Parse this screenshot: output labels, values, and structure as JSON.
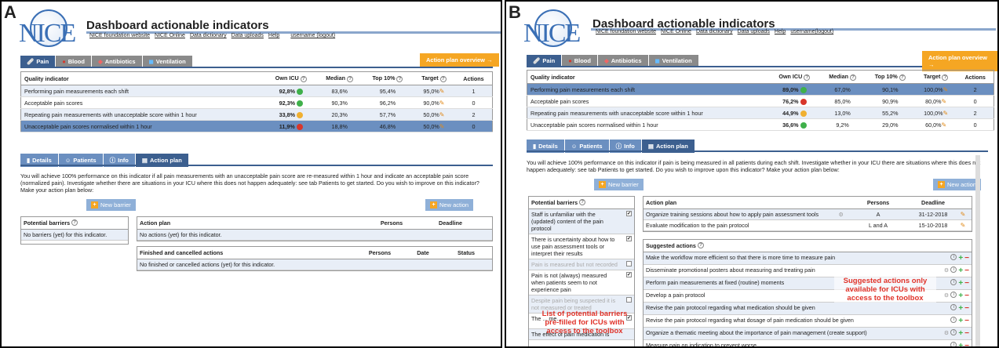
{
  "panelA": {
    "label": "A",
    "title": "Dashboard actionable indicators",
    "links": [
      "NICE foundation website",
      "NICE Online",
      "Data dictionary",
      "Data uploads",
      "Help",
      "username (logout)"
    ],
    "tabs": [
      "Pain",
      "Blood",
      "Antibiotics",
      "Ventilation"
    ],
    "action_plan_btn": "Action plan overview →",
    "table": {
      "headers": [
        "Quality indicator",
        "Own ICU",
        "Median",
        "Top 10%",
        "Target",
        "Actions"
      ],
      "rows": [
        {
          "qi": "Performing pain measurements each shift",
          "own": "92,8%",
          "median": "83,6%",
          "top": "95,4%",
          "target": "95,0%",
          "actions": "1",
          "status": "g"
        },
        {
          "qi": "Acceptable pain scores",
          "own": "92,3%",
          "median": "90,3%",
          "top": "96,2%",
          "target": "90,0%",
          "actions": "0",
          "status": "g"
        },
        {
          "qi": "Repeating pain measurements with unacceptable score within 1 hour",
          "own": "33,8%",
          "median": "20,3%",
          "top": "57,7%",
          "target": "50,0%",
          "actions": "2",
          "status": "o"
        },
        {
          "qi": "Unacceptable pain scores normalised within 1 hour",
          "own": "11,9%",
          "median": "18,8%",
          "top": "46,8%",
          "target": "50,0%",
          "actions": "0",
          "status": "r"
        }
      ]
    },
    "subtabs": [
      "Details",
      "Patients",
      "Info",
      "Action plan"
    ],
    "para": "You will achieve 100% performance on this indicator if all pain measurements with an unacceptable pain score are re-measured within 1 hour and indicate an acceptable pain score (normalized pain). Investigate whether there are situations in your ICU where this does not happen adequately: see tab Patients to get started. Do you wish to improve on this indicator? Make your action plan below:",
    "new_barrier": "New barrier",
    "new_action": "New action",
    "barriers_head": "Potential barriers",
    "barriers_empty": "No barriers (yet) for this indicator.",
    "ap_head": [
      "Action plan",
      "Persons",
      "Deadline"
    ],
    "ap_empty": "No actions (yet) for this indicator.",
    "fin_head": [
      "Finished and cancelled actions",
      "Persons",
      "Date",
      "Status"
    ],
    "fin_empty": "No finished or cancelled actions (yet) for this indicator."
  },
  "panelB": {
    "label": "B",
    "title": "Dashboard actionable indicators",
    "links": [
      "NICE foundation website",
      "NICE Online",
      "Data dictionary",
      "Data uploads",
      "Help",
      "username(logout)"
    ],
    "tabs": [
      "Pain",
      "Blood",
      "Antibiotics",
      "Ventilation"
    ],
    "action_plan_btn": "Action plan overview →",
    "table": {
      "headers": [
        "Quality indicator",
        "Own ICU",
        "Median",
        "Top 10%",
        "Target",
        "Actions"
      ],
      "rows": [
        {
          "qi": "Performing pain measurements each shift",
          "own": "89,0%",
          "median": "67,0%",
          "top": "90,1%",
          "target": "100,0%",
          "actions": "2",
          "status": "g"
        },
        {
          "qi": "Acceptable pain scores",
          "own": "76,2%",
          "median": "85,0%",
          "top": "90,9%",
          "target": "80,0%",
          "actions": "0",
          "status": "r"
        },
        {
          "qi": "Repeating pain measurements with unacceptable score within 1 hour",
          "own": "44,9%",
          "median": "13,0%",
          "top": "55,2%",
          "target": "100,0%",
          "actions": "2",
          "status": "o"
        },
        {
          "qi": "Unacceptable pain scores normalised within 1 hour",
          "own": "36,6%",
          "median": "9,2%",
          "top": "29,0%",
          "target": "60,0%",
          "actions": "0",
          "status": "g"
        }
      ]
    },
    "subtabs": [
      "Details",
      "Patients",
      "Info",
      "Action plan"
    ],
    "para": "You will achieve 100% performance on this indicator if pain is being measured in all patients during each shift. Investigate whether in your ICU there are situations where this does not happen adequately: see tab Patients to get started. Do you wish to improve upon this indicator? Make your action plan below:",
    "new_barrier": "New barrier",
    "new_action": "New action",
    "barriers_head": "Potential barriers",
    "barriers": [
      {
        "text": "Staff is unfamiliar with the (updated) content of the pain protocol",
        "checked": true,
        "muted": false
      },
      {
        "text": "There is uncertainty about how to use pain assessment tools or interpret their results",
        "checked": true,
        "muted": false
      },
      {
        "text": "Pain is measured but not recorded",
        "checked": false,
        "muted": true
      },
      {
        "text": "Pain is not (always) measured when patients seem to not experience pain",
        "checked": true,
        "muted": false
      },
      {
        "text": "Despite pain being suspected it is not measured or treated",
        "checked": false,
        "muted": true
      },
      {
        "text": "The ... me...",
        "checked": true,
        "muted": false
      },
      {
        "text": "The effect of pain medication is",
        "checked": false,
        "muted": false
      }
    ],
    "ap_head": [
      "Action plan",
      "Persons",
      "Deadline"
    ],
    "ap_rows": [
      {
        "text": "Organize training sessions about how to apply pain assessment tools",
        "persons": "A",
        "deadline": "31-12-2018"
      },
      {
        "text": "Evaluate modification to the pain protocol",
        "persons": "L and A",
        "deadline": "15-10-2018"
      }
    ],
    "sug_head": "Suggested actions",
    "sug_rows": [
      "Make the workflow more efficient so that there is more time to measure pain",
      "Disseminate promotional posters about measuring and treating pain",
      "Perform pain measurements at fixed (routine) moments",
      "Develop a pain protocol",
      "Revise the pain protocol regarding what medication should be given",
      "Revise the pain protocol regarding what dosage of pain medication should be given",
      "Organize a thematic meeting about the importance of pain management (create support)",
      "Measure pain on indication to prevent worse"
    ],
    "annot_barriers": "List of potential barriers pre-filled for ICUs with access to the toolbox",
    "annot_actions": "Suggested actions only available for ICUs with access to the toolbox"
  },
  "colors": {
    "accent": "#3c5f8f",
    "orange": "#f5a623",
    "green": "#3fb04a",
    "red": "#d8362a",
    "annot": "#e0332a"
  }
}
